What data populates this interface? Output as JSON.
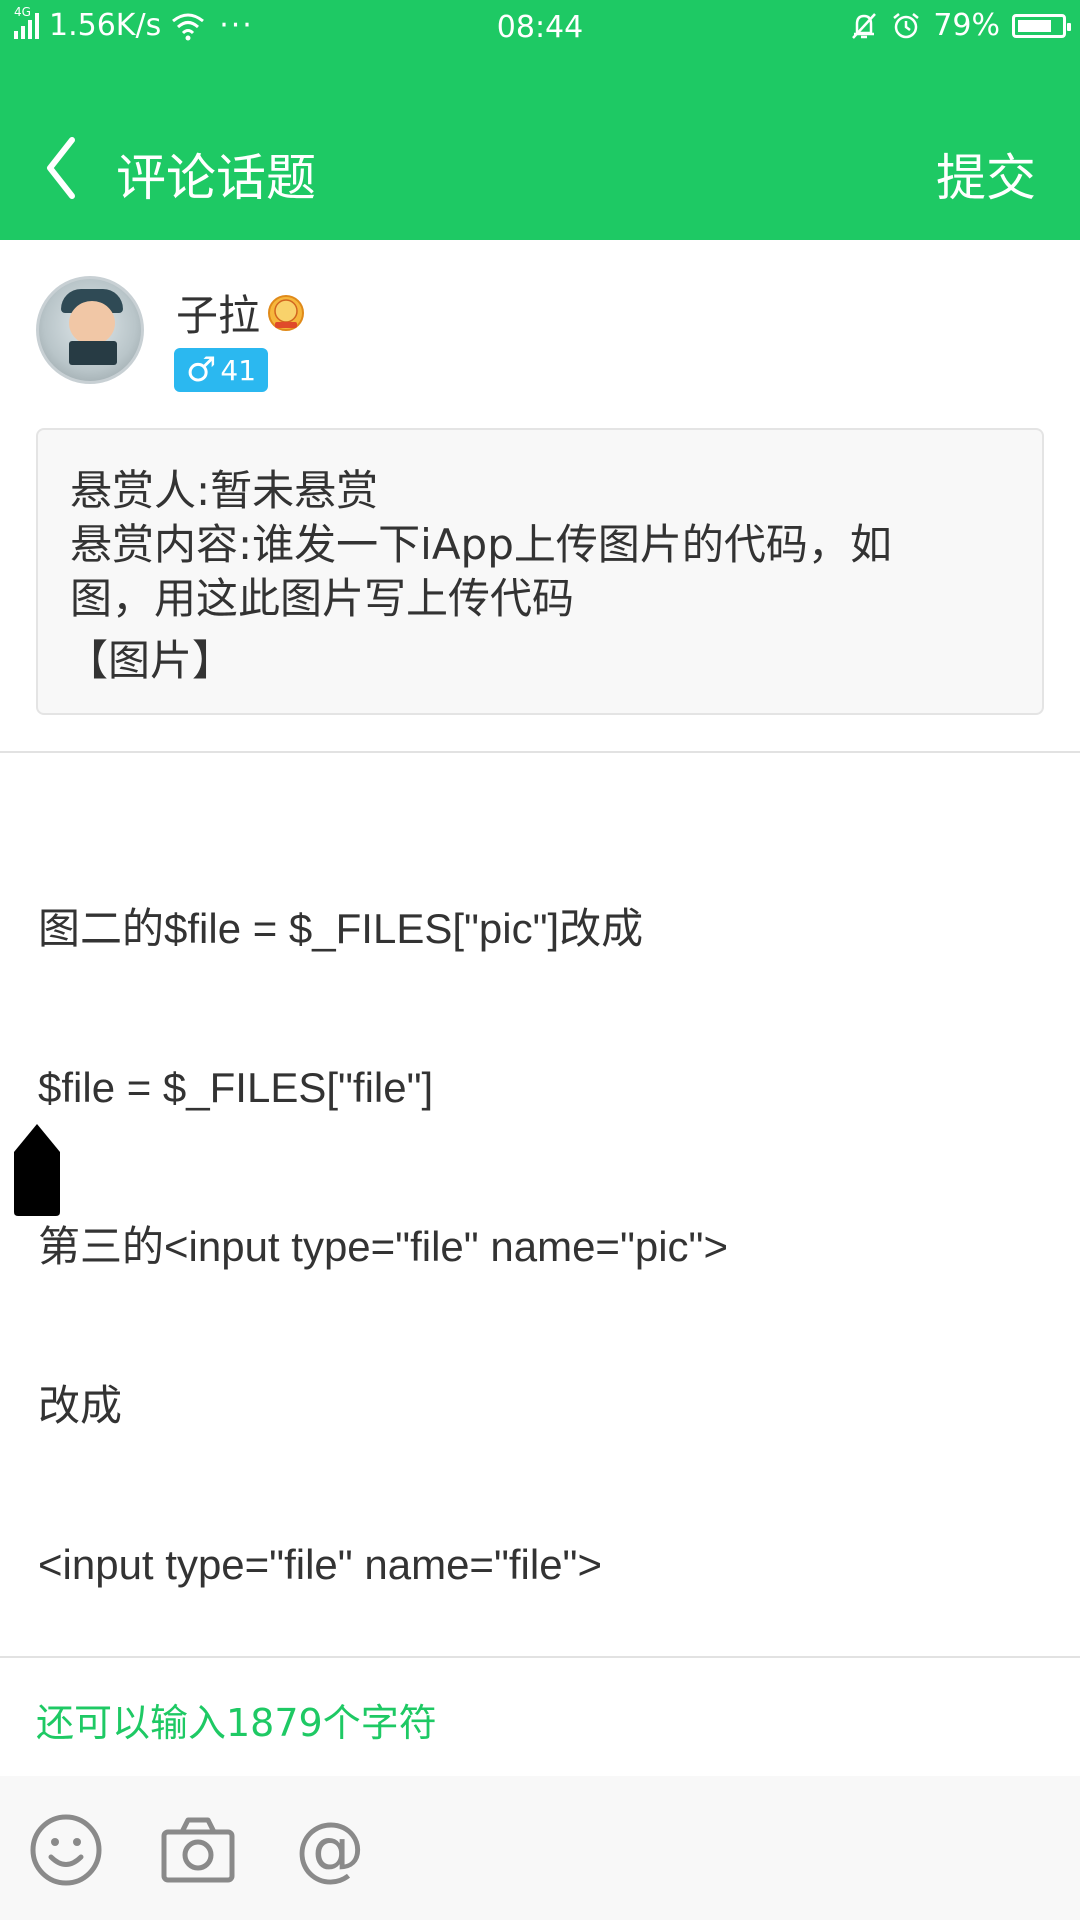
{
  "status_bar": {
    "network_type": "4G",
    "net_speed": "1.56K/s",
    "more": "···",
    "time": "08:44",
    "battery": "79%",
    "battery_level": 0.79,
    "icons": [
      "signal-icon",
      "wifi-icon",
      "silent-bell-icon",
      "alarm-icon",
      "battery-icon"
    ]
  },
  "nav": {
    "title": "评论话题",
    "submit_label": "提交",
    "back_icon": "chevron-left-icon"
  },
  "author": {
    "name": "子拉",
    "gender_symbol": "♂",
    "level": "41",
    "badge_color": "#2bb8f0"
  },
  "reward": {
    "line1": "悬赏人:暂未悬赏",
    "line2": "悬赏内容:谁发一下iApp上传图片的代码，如",
    "line3": "图，用这此图片写上传代码",
    "image_tag": "【图片】"
  },
  "comment": {
    "lines": [
      "图二的$file = $_FILES[\"pic\"]改成",
      "$file = $_FILES[\"file\"]",
      "第三的<input type=\"file\" name=\"pic\">",
      "改成",
      "<input type=\"file\" name=\"file\">"
    ]
  },
  "counter": "还可以输入1879个字符",
  "toolbar": {
    "items": [
      "emoji-icon",
      "camera-icon",
      "at-mention-icon"
    ]
  },
  "colors": {
    "accent": "#1ec964",
    "text": "#333333",
    "card_bg": "#f8f8f8"
  }
}
